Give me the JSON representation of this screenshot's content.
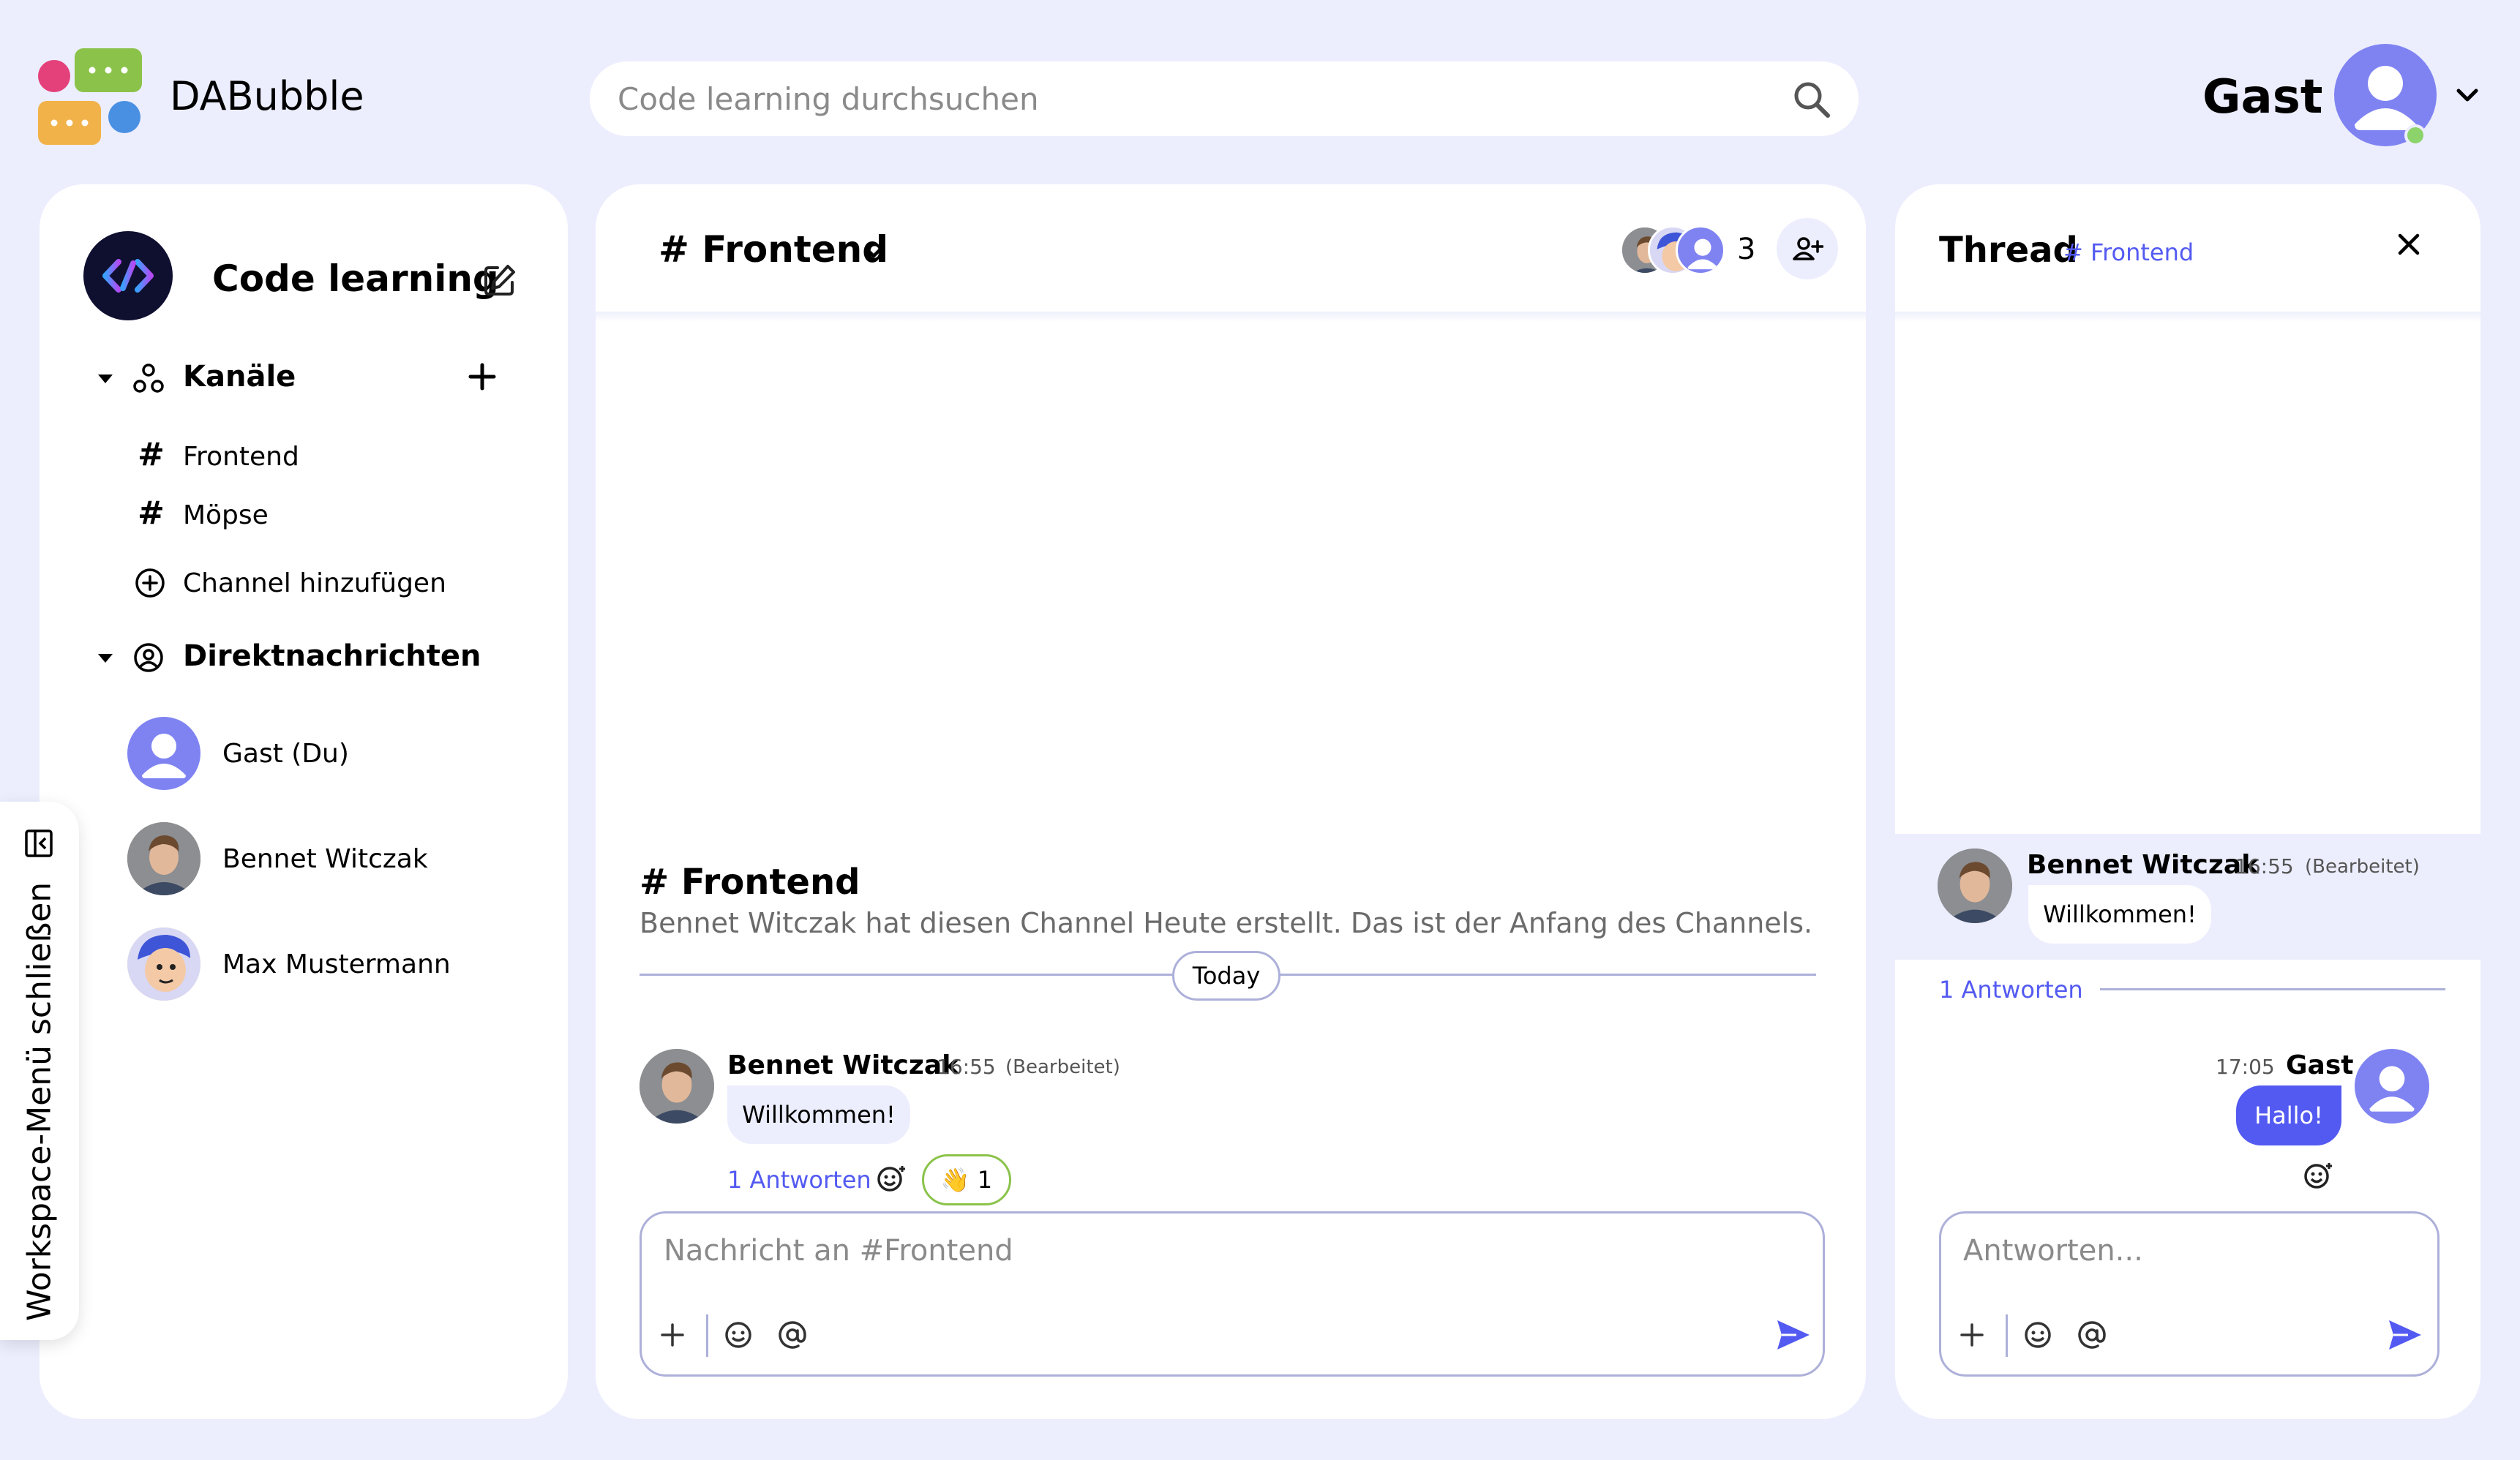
{
  "app": {
    "name": "DABubble"
  },
  "search": {
    "placeholder": "Code learning durchsuchen"
  },
  "user": {
    "name": "Gast",
    "status_color": "#8BD36A"
  },
  "workspace": {
    "name": "Code learning",
    "channels_label": "Kanäle",
    "channels": [
      {
        "label": "Frontend"
      },
      {
        "label": "Möpse"
      }
    ],
    "add_channel_label": "Channel hinzufügen",
    "dm_label": "Direktnachrichten",
    "dms": [
      {
        "name": "Gast (Du)"
      },
      {
        "name": "Bennet Witczak"
      },
      {
        "name": "Max Mustermann"
      }
    ],
    "toggle_menu_label": "Workspace-Menü schließen"
  },
  "channel": {
    "title": "# Frontend",
    "member_count": "3",
    "intro_title": "# Frontend",
    "intro_text": "Bennet Witczak hat diesen Channel Heute erstellt. Das ist der Anfang des Channels.",
    "date_label": "Today",
    "messages": [
      {
        "author": "Bennet Witczak",
        "time": "16:55",
        "edited": "(Bearbeitet)",
        "text": "Willkommen!",
        "replies": "1 Antworten",
        "reaction_emoji": "👋",
        "reaction_count": "1"
      }
    ],
    "composer_placeholder": "Nachricht an #Frontend"
  },
  "thread": {
    "title": "Thread",
    "channel": "# Frontend",
    "root": {
      "author": "Bennet Witczak",
      "time": "16:55",
      "edited": "(Bearbeitet)",
      "text": "Willkommen!"
    },
    "replies_count": "1 Antworten",
    "replies": [
      {
        "author": "Gast",
        "time": "17:05",
        "text": "Hallo!"
      }
    ],
    "composer_placeholder": "Antworten..."
  },
  "colors": {
    "accent": "#535AF1",
    "avatar": "#7F83F2",
    "background": "#ECEEFE",
    "border": "#ADB0D9",
    "reaction_border": "#8BC34A"
  }
}
